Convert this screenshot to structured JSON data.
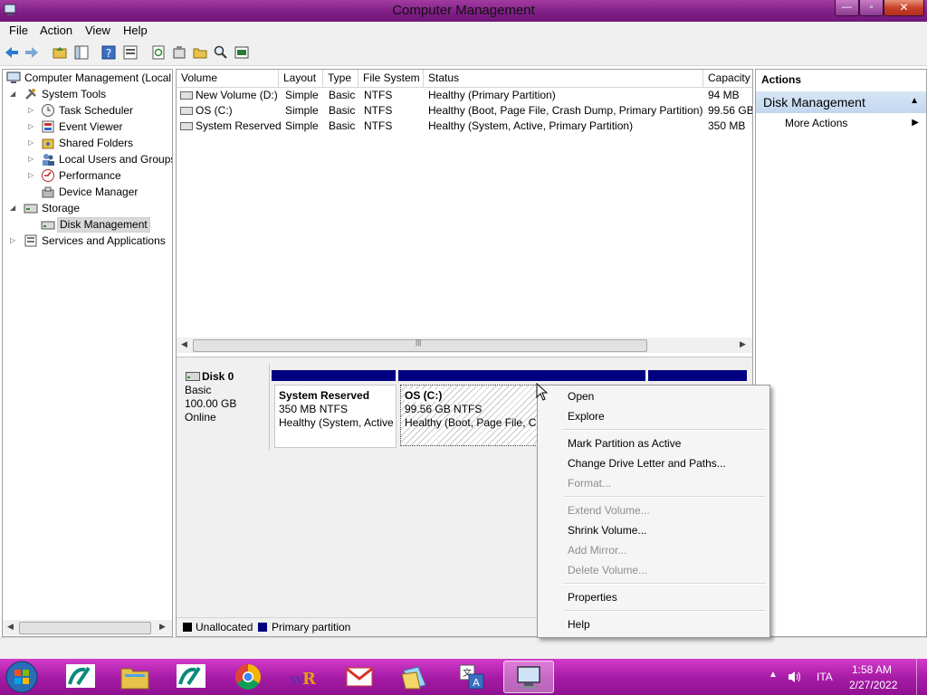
{
  "window": {
    "title": "Computer Management",
    "min_label": "—",
    "max_label": "▫",
    "close_label": "✕"
  },
  "menu": [
    "File",
    "Action",
    "View",
    "Help"
  ],
  "toolbar": {
    "icons": [
      "back-icon",
      "forward-icon",
      "up-folder-icon",
      "show-hide-tree-icon",
      "help-icon",
      "properties-icon",
      "refresh-icon",
      "settings-icon",
      "open-folder-icon",
      "search-icon",
      "disk-properties-icon"
    ]
  },
  "tree": [
    {
      "label": "Computer Management (Local",
      "level": 0,
      "expander": "",
      "icon": "computer-icon"
    },
    {
      "label": "System Tools",
      "level": 1,
      "expander": "◢",
      "icon": "tools-icon"
    },
    {
      "label": "Task Scheduler",
      "level": 2,
      "expander": "▷",
      "icon": "clock-icon"
    },
    {
      "label": "Event Viewer",
      "level": 2,
      "expander": "▷",
      "icon": "event-viewer-icon"
    },
    {
      "label": "Shared Folders",
      "level": 2,
      "expander": "▷",
      "icon": "shared-folder-icon"
    },
    {
      "label": "Local Users and Groups",
      "level": 2,
      "expander": "▷",
      "icon": "users-icon"
    },
    {
      "label": "Performance",
      "level": 2,
      "expander": "▷",
      "icon": "performance-icon"
    },
    {
      "label": "Device Manager",
      "level": 2,
      "expander": "",
      "icon": "device-manager-icon"
    },
    {
      "label": "Storage",
      "level": 1,
      "expander": "◢",
      "icon": "storage-icon"
    },
    {
      "label": "Disk Management",
      "level": 2,
      "expander": "",
      "icon": "disk-icon",
      "selected": true
    },
    {
      "label": "Services and Applications",
      "level": 1,
      "expander": "▷",
      "icon": "services-icon"
    }
  ],
  "volumes": {
    "columns": [
      "Volume",
      "Layout",
      "Type",
      "File System",
      "Status",
      "Capacity"
    ],
    "rows": [
      [
        "New Volume (D:)",
        "Simple",
        "Basic",
        "NTFS",
        "Healthy (Primary Partition)",
        "94 MB"
      ],
      [
        "OS (C:)",
        "Simple",
        "Basic",
        "NTFS",
        "Healthy (Boot, Page File, Crash Dump, Primary Partition)",
        "99.56 GB"
      ],
      [
        "System Reserved",
        "Simple",
        "Basic",
        "NTFS",
        "Healthy (System, Active, Primary Partition)",
        "350 MB"
      ]
    ]
  },
  "disk": {
    "name": "Disk 0",
    "type": "Basic",
    "size": "100.00 GB",
    "state": "Online",
    "partitions": [
      {
        "name": "System Reserved",
        "size": "350 MB NTFS",
        "status": "Healthy (System, Active"
      },
      {
        "name": "OS  (C:)",
        "size": "99.56 GB NTFS",
        "status": "Healthy (Boot, Page File, Cr"
      }
    ]
  },
  "legend": [
    {
      "label": "Unallocated",
      "color": "#000000"
    },
    {
      "label": "Primary partition",
      "color": "#000080"
    }
  ],
  "actions": {
    "header": "Actions",
    "section": "Disk Management",
    "more": "More Actions"
  },
  "context_menu": [
    {
      "label": "Open",
      "enabled": true
    },
    {
      "label": "Explore",
      "enabled": true
    },
    {
      "label": "Mark Partition as Active",
      "enabled": true
    },
    {
      "label": "Change Drive Letter and Paths...",
      "enabled": true
    },
    {
      "label": "Format...",
      "enabled": false
    },
    {
      "label": "Extend Volume...",
      "enabled": false
    },
    {
      "label": "Shrink Volume...",
      "enabled": true
    },
    {
      "label": "Add Mirror...",
      "enabled": false
    },
    {
      "label": "Delete Volume...",
      "enabled": false
    },
    {
      "label": "Properties",
      "enabled": true
    },
    {
      "label": "Help",
      "enabled": true
    }
  ],
  "taskbar": {
    "apps": [
      "credit-agricole-icon",
      "file-explorer-icon",
      "credit-agricole-icon",
      "chrome-icon",
      "winrar-icon",
      "gmail-icon",
      "folders-icon",
      "translate-icon",
      "computer-management-icon"
    ],
    "language": "ITA",
    "time": "1:58 AM",
    "date": "2/27/2022"
  },
  "colors": {
    "title_bar": "#8c2a93",
    "taskbar": "#b324b0",
    "primary_partition": "#000080",
    "selection": "#cce8ff"
  }
}
